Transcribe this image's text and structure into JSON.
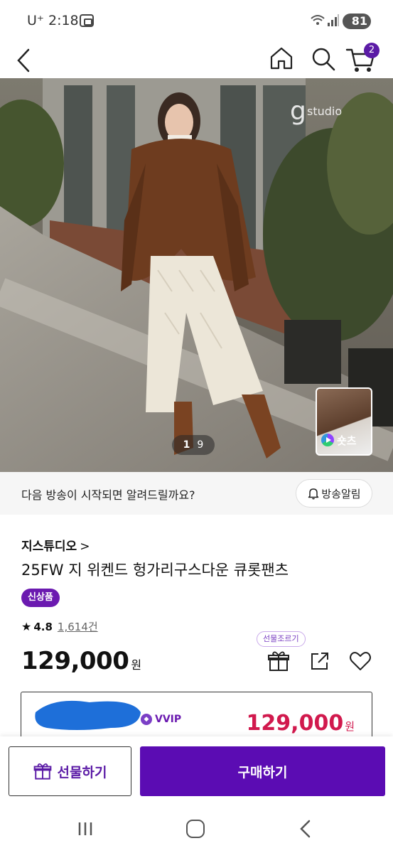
{
  "status_bar": {
    "carrier": "U⁺ 2:18",
    "battery": "81"
  },
  "header": {
    "back_icon": "chevron-left-icon",
    "home_icon": "home-icon",
    "search_icon": "search-icon",
    "cart_icon": "cart-icon",
    "cart_count": "2"
  },
  "hero": {
    "brand_watermark": "studio",
    "page_current": "1",
    "page_total": "9",
    "shorts_label": "숏츠"
  },
  "notify": {
    "message": "다음 방송이 시작되면 알려드릴까요?",
    "button_label": "방송알림"
  },
  "product": {
    "brand": "지스튜디오",
    "brand_chevron": ">",
    "title": "25FW 지 위켄드 헝가리구스다운 큐롯팬츠",
    "badge": "신상품",
    "rating_star": "★",
    "rating": "4.8",
    "review_count": "1,614건",
    "price": "129,000",
    "price_unit": "원",
    "gift_tooltip": "선물조르기"
  },
  "vip": {
    "tier": "VVIP",
    "price": "129,000",
    "price_unit": "원"
  },
  "actions": {
    "gift_label": "선물하기",
    "buy_label": "구매하기"
  },
  "colors": {
    "brand_purple": "#5b0cb3",
    "vip_price_red": "#d1194d",
    "badge_purple": "#6b1ab0"
  }
}
